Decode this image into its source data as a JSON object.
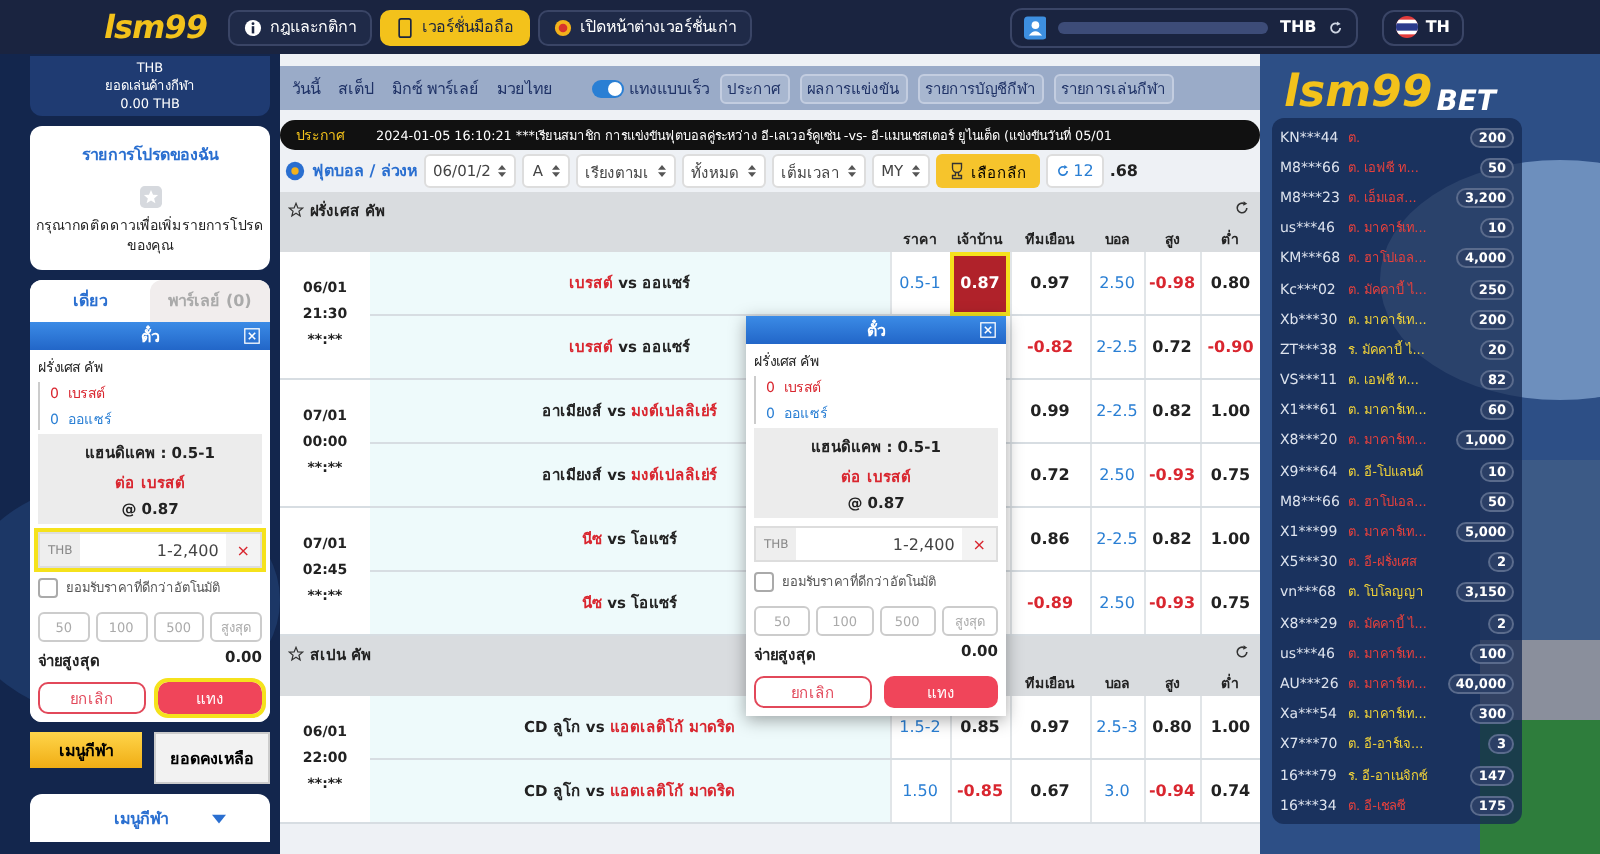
{
  "header": {
    "logo": "lsm99",
    "nav": [
      {
        "label": "กฎและกติกา",
        "selected": false
      },
      {
        "label": "เวอร์ชั่นมือถือ",
        "selected": true
      },
      {
        "label": "เปิดหน้าต่างเวอร์ชั่นเก่า",
        "selected": false
      }
    ],
    "currency": "THB",
    "language": "TH"
  },
  "balance": {
    "currency": "THB",
    "label": "ยอดเล่นค้างกีฬา",
    "amount": "0.00 THB"
  },
  "favorites": {
    "title": "รายการโปรดของฉัน",
    "message": "กรุณากดติดดาวเพื่อเพิ่มรายการโปรดของคุณ"
  },
  "slip_tabs": [
    {
      "label": "เดี่ยว",
      "selected": true
    },
    {
      "label": "พาร์เลย์ (0)",
      "selected": false
    }
  ],
  "bet_slips": [
    {
      "kind": "docked",
      "highlighted": true,
      "title": "ตั๋ว",
      "league": "ฝรั่งเศส คัพ",
      "home_score": "0",
      "home": "เบรสต์",
      "away_score": "0",
      "away": "ออแซร์",
      "market": "แฮนดิแคพ : 0.5-1",
      "pick": "ต่อ เบรสต์",
      "odds": "@ 0.87",
      "currency": "THB",
      "stake_placeholder": "1-2,400",
      "clear": "×",
      "auto_accept": {
        "label": "ยอมรับราคาที่ดีกว่าอัตโนมัติ",
        "checked": false
      },
      "quick": [
        "50",
        "100",
        "500",
        "สูงสุด"
      ],
      "payout_label": "จ่ายสูงสุด",
      "payout": "0.00",
      "cancel": "ยกเลิก",
      "place": "แทง"
    },
    {
      "kind": "popup",
      "highlighted": false,
      "title": "ตั๋ว",
      "league": "ฝรั่งเศส คัพ",
      "home_score": "0",
      "home": "เบรสต์",
      "away_score": "0",
      "away": "ออแซร์",
      "market": "แฮนดิแคพ : 0.5-1",
      "pick": "ต่อ เบรสต์",
      "odds": "@ 0.87",
      "currency": "THB",
      "stake_placeholder": "1-2,400",
      "clear": "×",
      "auto_accept": {
        "label": "ยอมรับราคาที่ดีกว่าอัตโนมัติ",
        "checked": false
      },
      "quick": [
        "50",
        "100",
        "500",
        "สูงสุด"
      ],
      "payout_label": "จ่ายสูงสุด",
      "payout": "0.00",
      "cancel": "ยกเลิก",
      "place": "แทง"
    }
  ],
  "side_buttons": [
    {
      "label": "เมนูกีฬา",
      "kind": "primary"
    },
    {
      "label": "ยอดคงเหลือ",
      "kind": "secondary"
    }
  ],
  "sports_menu": {
    "label": "เมนูกีฬา"
  },
  "top_nav": {
    "tabs": [
      "วันนี้",
      "สเต็ป",
      "มิกซ์ พาร์เลย์",
      "มวยไทย"
    ],
    "quick_bet": {
      "label": "แทงแบบเร็ว",
      "on": true
    },
    "buttons": [
      "ประกาศ",
      "ผลการแข่งขัน",
      "รายการบัญชีกีฬา",
      "รายการเล่นกีฬา"
    ]
  },
  "announcement": {
    "label": "ประกาศ",
    "text": "2024-01-05 16:10:21 ***เรียนสมาชิก การแข่งขันฟุตบอลคู่ระหว่าง อี-เลเวอร์คูเซ่น -vs- อี-แมนเชสเตอร์ ยูไนเต็ด (แข่งขันวันที่ 05/01"
  },
  "filters": {
    "breadcrumb": "ฟุตบอล / ล่วงห",
    "selects": [
      "06/01/2",
      "A",
      "เรียงตามเ",
      "ทั้งหมด",
      "เต็มเวลา",
      "MY"
    ],
    "league_button": "เลือกลีก",
    "refresh_count": "12",
    "extra": ".68"
  },
  "leagues": [
    {
      "name": "ฝรั่งเศส คัพ",
      "columns": [
        "ราคา",
        "เจ้าบ้าน",
        "ทีมเยือน",
        "บอล",
        "สูง",
        "ต่ำ"
      ],
      "matches": [
        {
          "date": "06/01",
          "time": "21:30",
          "live": "**:**",
          "lines": [
            {
              "home": "เบรสต์",
              "away": "ออแซร์",
              "home_favored": true,
              "away_favored": false,
              "vs": "vs",
              "odds": [
                "0.5-1",
                "0.87",
                "0.97",
                "2.50",
                "-0.98",
                "0.80"
              ],
              "selected": true
            },
            {
              "home": "เบรสต์",
              "away": "ออแซร์",
              "home_favored": true,
              "away_favored": false,
              "vs": "vs",
              "odds": [
                "-0.82",
                "2-2.5",
                "0.72",
                "-0.90"
              ],
              "selected": false
            }
          ]
        },
        {
          "date": "07/01",
          "time": "00:00",
          "live": "**:**",
          "lines": [
            {
              "home": "อาเมียงส์",
              "away": "มงต์เปลลิเย่ร์",
              "home_favored": false,
              "away_favored": true,
              "vs": "vs",
              "odds": [
                "0.99",
                "2-2.5",
                "0.82",
                "1.00"
              ],
              "selected": false
            },
            {
              "home": "อาเมียงส์",
              "away": "มงต์เปลลิเย่ร์",
              "home_favored": false,
              "away_favored": true,
              "vs": "vs",
              "odds": [
                "0.72",
                "2.50",
                "-0.93",
                "0.75"
              ],
              "selected": false
            }
          ]
        },
        {
          "date": "07/01",
          "time": "02:45",
          "live": "**:**",
          "lines": [
            {
              "home": "นีซ",
              "away": "โอแซร์",
              "home_favored": true,
              "away_favored": false,
              "vs": "vs",
              "odds": [
                "0.86",
                "2-2.5",
                "0.82",
                "1.00"
              ],
              "selected": false
            },
            {
              "home": "นีซ",
              "away": "โอแซร์",
              "home_favored": true,
              "away_favored": false,
              "vs": "vs",
              "odds": [
                "-0.89",
                "2.50",
                "-0.93",
                "0.75"
              ],
              "selected": false
            }
          ]
        }
      ]
    },
    {
      "name": "สเปน คัพ",
      "columns": [
        "ทีมเยือน",
        "บอล",
        "สูง",
        "ต่ำ"
      ],
      "matches": [
        {
          "date": "06/01",
          "time": "22:00",
          "live": "**:**",
          "lines": [
            {
              "home": "CD ลูโก",
              "away": "แอตเลติโก้ มาดริด",
              "home_favored": false,
              "away_favored": true,
              "vs": "vs",
              "odds": [
                "1.5-2",
                "0.85",
                "0.97",
                "2.5-3",
                "0.80",
                "1.00"
              ],
              "selected": false
            },
            {
              "home": "CD ลูโก",
              "away": "แอตเลติโก้ มาดริด",
              "home_favored": false,
              "away_favored": true,
              "vs": "vs",
              "odds": [
                "1.50",
                "-0.85",
                "0.67",
                "3.0",
                "-0.94",
                "0.74"
              ],
              "selected": false
            }
          ]
        }
      ]
    }
  ],
  "brand": {
    "logo": "lsm99",
    "tag": "BET"
  },
  "recent_bets": [
    {
      "user": "KN***44",
      "team": "ต.",
      "amount": "200",
      "color": "#e8413c"
    },
    {
      "user": "M8***66",
      "team": "ต. เอฟซี ท...",
      "amount": "50",
      "color": "#e8413c"
    },
    {
      "user": "M8***23",
      "team": "ต. เอ็มเอส...",
      "amount": "3,200",
      "color": "#e8413c"
    },
    {
      "user": "us***46",
      "team": "ต. มาคาร์เท...",
      "amount": "10",
      "color": "#e8413c"
    },
    {
      "user": "KM***68",
      "team": "ต. ฮาโปเอล...",
      "amount": "4,000",
      "color": "#e8413c"
    },
    {
      "user": "Kc***02",
      "team": "ต. มัคคาบี้ ไ...",
      "amount": "250",
      "color": "#e8413c"
    },
    {
      "user": "Xb***30",
      "team": "ต. มาคาร์เท...",
      "amount": "200",
      "color": "#f2d338"
    },
    {
      "user": "ZT***38",
      "team": "ร. มัคคาบี้ ไ...",
      "amount": "20",
      "color": "#f2d338"
    },
    {
      "user": "VS***11",
      "team": "ต. เอฟซี ท...",
      "amount": "82",
      "color": "#f2d338"
    },
    {
      "user": "X1***61",
      "team": "ต. มาคาร์เท...",
      "amount": "60",
      "color": "#f2d338"
    },
    {
      "user": "X8***20",
      "team": "ต. มาคาร์เท...",
      "amount": "1,000",
      "color": "#e8413c"
    },
    {
      "user": "X9***64",
      "team": "ต. อี-โปแลนด์",
      "amount": "10",
      "color": "#f2d338"
    },
    {
      "user": "M8***66",
      "team": "ต. ฮาโปเอล...",
      "amount": "50",
      "color": "#e8413c"
    },
    {
      "user": "X1***99",
      "team": "ต. มาคาร์เท...",
      "amount": "5,000",
      "color": "#e8413c"
    },
    {
      "user": "X5***30",
      "team": "ต. อี-ฝรั่งเศส",
      "amount": "2",
      "color": "#e8413c"
    },
    {
      "user": "vn***68",
      "team": "ต. โบโลญญา",
      "amount": "3,150",
      "color": "#f2d338"
    },
    {
      "user": "X8***29",
      "team": "ต. มัคคาบี้ ไ...",
      "amount": "2",
      "color": "#e8413c"
    },
    {
      "user": "us***46",
      "team": "ต. มาคาร์เท...",
      "amount": "100",
      "color": "#e8413c"
    },
    {
      "user": "AU***26",
      "team": "ต. มาคาร์เท...",
      "amount": "40,000",
      "color": "#e8413c"
    },
    {
      "user": "Xa***54",
      "team": "ต. มาคาร์เท...",
      "amount": "300",
      "color": "#f2d338"
    },
    {
      "user": "X7***70",
      "team": "ต. อี-อาร์เจ...",
      "amount": "3",
      "color": "#f2d338"
    },
    {
      "user": "16***79",
      "team": "ร. อี-อาเนจิกซ์",
      "amount": "147",
      "color": "#f2d338"
    },
    {
      "user": "16***34",
      "team": "ต. อี-เชลซี",
      "amount": "175",
      "color": "#e8413c"
    }
  ]
}
